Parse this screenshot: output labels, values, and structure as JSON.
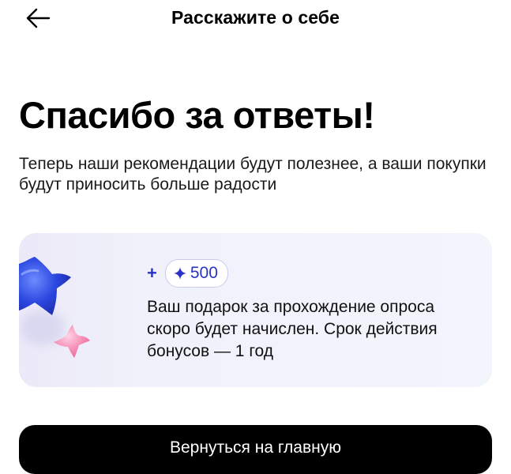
{
  "header": {
    "back_icon": "arrow-left-icon",
    "title": "Расскажите о себе"
  },
  "main": {
    "title": "Спасибо за ответы!",
    "subtitle": "Теперь наши рекомендации будут полезнее, а ваши покупки будут приносить больше радости"
  },
  "bonus_card": {
    "decor_icons": [
      "blue-star-icon",
      "pink-star-icon"
    ],
    "plus": "+",
    "spark_icon": "sparkle-icon",
    "amount": "500",
    "message": "Ваш подарок за прохождение опроса скоро будет начислен. Срок действия бонусов — 1 год"
  },
  "actions": {
    "home_button_label": "Вернуться на главную"
  },
  "colors": {
    "accent_blue": "#2a33c8",
    "card_background": "#f1f2fc",
    "button_background": "#000000"
  }
}
